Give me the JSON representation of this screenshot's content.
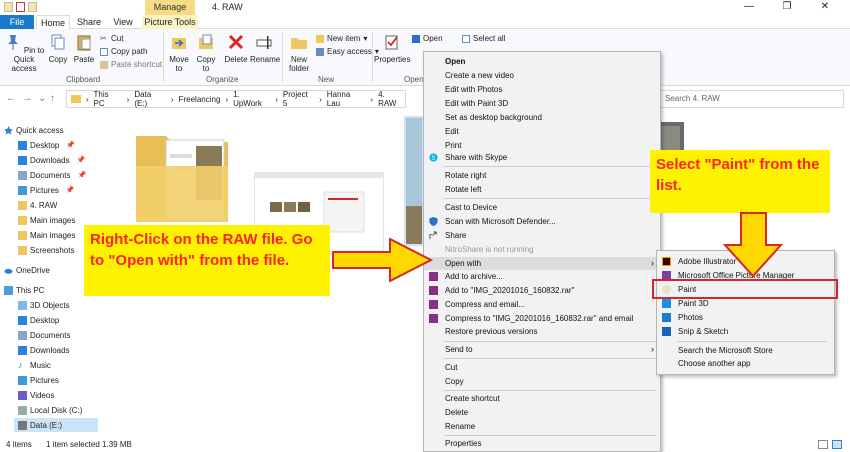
{
  "window": {
    "manage_tab": "Manage",
    "title": "4. RAW",
    "minimize": "—",
    "maximize": "❐",
    "close": "✕"
  },
  "tabs": {
    "file": "File",
    "home": "Home",
    "share": "Share",
    "view": "View",
    "picture_tools": "Picture Tools"
  },
  "ribbon": {
    "pin_quick_access": "Pin to Quick access",
    "copy": "Copy",
    "paste": "Paste",
    "cut": "Cut",
    "copy_path": "Copy path",
    "paste_shortcut": "Paste shortcut",
    "clipboard_label": "Clipboard",
    "move_to": "Move to",
    "copy_to": "Copy to",
    "delete": "Delete",
    "rename": "Rename",
    "organize_label": "Organize",
    "new_folder": "New folder",
    "new_item": "New item",
    "easy_access": "Easy access",
    "new_label": "New",
    "properties": "Properties",
    "open_btn": "Open",
    "open_label": "Open",
    "select_all": "Select all"
  },
  "address": {
    "path": [
      "This PC",
      "Data (E:)",
      "Freelancing",
      "1. UpWork",
      "Project 5",
      "Hanna Lau",
      "4. RAW"
    ],
    "search_placeholder": "Search 4. RAW"
  },
  "sidebar": {
    "items": [
      {
        "label": "Quick access"
      },
      {
        "label": "Desktop"
      },
      {
        "label": "Downloads"
      },
      {
        "label": "Documents"
      },
      {
        "label": "Pictures"
      },
      {
        "label": "4. RAW"
      },
      {
        "label": "Main images"
      },
      {
        "label": "Main images"
      },
      {
        "label": "Screenshots"
      },
      {
        "label": "OneDrive"
      },
      {
        "label": "This PC"
      },
      {
        "label": "3D Objects"
      },
      {
        "label": "Desktop"
      },
      {
        "label": "Documents"
      },
      {
        "label": "Downloads"
      },
      {
        "label": "Music"
      },
      {
        "label": "Pictures"
      },
      {
        "label": "Videos"
      },
      {
        "label": "Local Disk (C:)"
      },
      {
        "label": "Data (E:)"
      }
    ]
  },
  "status": {
    "items": "4 items",
    "selected": "1 item selected  1.39 MB"
  },
  "context_menu": {
    "items": [
      "Open",
      "Create a new video",
      "Edit with Photos",
      "Edit with Paint 3D",
      "Set as desktop background",
      "Edit",
      "Print",
      "Share with Skype",
      "Rotate right",
      "Rotate left",
      "Cast to Device",
      "Scan with Microsoft Defender...",
      "Share",
      "NitroShare is not running",
      "Open with",
      "Add to archive...",
      "Add to \"IMG_20201016_160832.rar\"",
      "Compress and email...",
      "Compress to \"IMG_20201016_160832.rar\" and email",
      "Restore previous versions",
      "Send to",
      "Cut",
      "Copy",
      "Create shortcut",
      "Delete",
      "Rename",
      "Properties"
    ]
  },
  "submenu": {
    "items": [
      "Adobe Illustrator",
      "Microsoft Office Picture Manager",
      "Paint",
      "Paint 3D",
      "Photos",
      "Snip & Sketch",
      "Search the Microsoft Store",
      "Choose another app"
    ]
  },
  "callouts": {
    "left": "Right-Click on the RAW file. Go to \"Open with\" from the file.",
    "right": "Select \"Paint\" from the list."
  },
  "colors": {
    "accent": "#1979ca",
    "callout_bg": "#fff200",
    "callout_text": "#ff2222",
    "arrow_fill": "#ffd800",
    "arrow_stroke": "#d7262b",
    "highlight_border": "#d7262b"
  }
}
